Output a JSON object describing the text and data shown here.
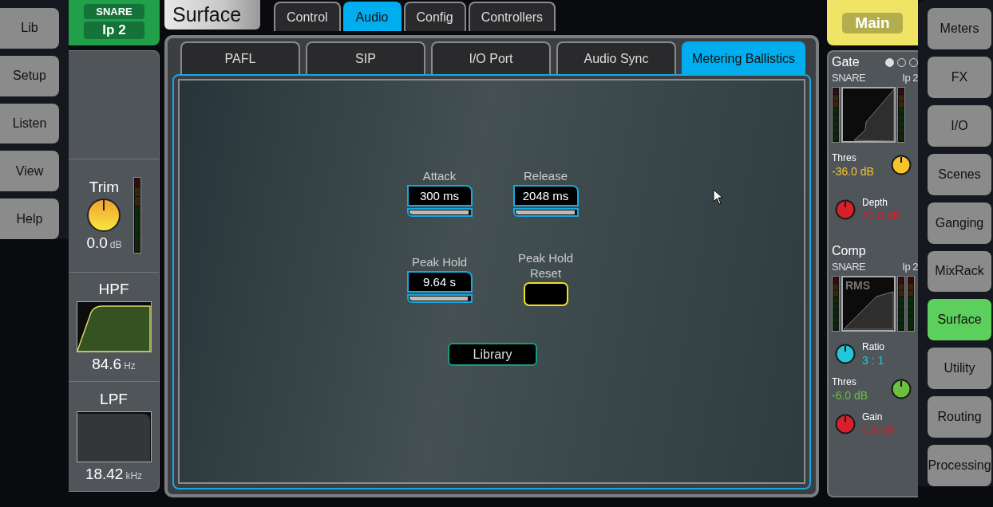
{
  "left_nav": [
    "Lib",
    "Setup",
    "Listen",
    "View",
    "Help"
  ],
  "channel": {
    "name": "SNARE",
    "source": "Ip 2",
    "trim": {
      "label": "Trim",
      "value": "0.0",
      "unit": "dB"
    },
    "hpf": {
      "label": "HPF",
      "value": "84.6",
      "unit": "Hz"
    },
    "lpf": {
      "label": "LPF",
      "value": "18.42",
      "unit": "kHz"
    }
  },
  "screen_title": "Surface",
  "tabs": [
    {
      "label": "Control",
      "selected": false
    },
    {
      "label": "Audio",
      "selected": true
    },
    {
      "label": "Config",
      "selected": false
    },
    {
      "label": "Controllers",
      "selected": false
    }
  ],
  "subtabs": [
    {
      "label": "PAFL",
      "selected": false
    },
    {
      "label": "SIP",
      "selected": false
    },
    {
      "label": "I/O Port",
      "selected": false
    },
    {
      "label": "Audio Sync",
      "selected": false
    },
    {
      "label": "Metering Ballistics",
      "selected": true
    }
  ],
  "settings": [
    {
      "kind": "slider",
      "label": "Attack",
      "value": "300 ms",
      "level": 0.98
    },
    {
      "kind": "slider",
      "label": "Release",
      "value": "2048 ms",
      "level": 0.98
    },
    {
      "kind": "slider",
      "label": "Peak Hold",
      "value": "9.64 s",
      "level": 0.97
    },
    {
      "kind": "button",
      "label": "Peak Hold Reset"
    }
  ],
  "library_button": "Library",
  "mix": "Main",
  "processing": [
    {
      "kind": "gate",
      "title": "Gate",
      "pages": [
        {
          "selected": true
        },
        {
          "selected": false
        },
        {
          "selected": false
        }
      ],
      "channel": "SNARE",
      "source": "Ip 2",
      "params": [
        {
          "kind": "knob_right",
          "label": "Thres",
          "value": "-36.0 dB",
          "color": "#f5c52a"
        },
        {
          "kind": "knob_left",
          "label": "Depth",
          "value": "20.0 dB",
          "color": "#d8202a"
        }
      ]
    },
    {
      "kind": "comp",
      "title": "Comp",
      "channel": "SNARE",
      "source": "Ip 2",
      "mode": "RMS",
      "params": [
        {
          "kind": "knob_left",
          "label": "Ratio",
          "value": "3 : 1",
          "color": "#22c8d8"
        },
        {
          "kind": "knob_right",
          "label": "Thres",
          "value": "-6.0 dB",
          "color": "#6cc040"
        },
        {
          "kind": "knob_left",
          "label": "Gain",
          "value": "0.0 dB",
          "color": "#d8202a"
        }
      ]
    }
  ],
  "right_nav": [
    {
      "label": "Meters",
      "selected": false
    },
    {
      "label": "FX",
      "selected": false
    },
    {
      "label": "I/O",
      "selected": false
    },
    {
      "label": "Scenes",
      "selected": false
    },
    {
      "label": "Ganging",
      "selected": false
    },
    {
      "label": "MixRack",
      "selected": false
    },
    {
      "label": "Surface",
      "selected": true
    },
    {
      "label": "Utility",
      "selected": false
    },
    {
      "label": "Routing",
      "selected": false
    },
    {
      "label": "Processing",
      "selected": false
    }
  ]
}
